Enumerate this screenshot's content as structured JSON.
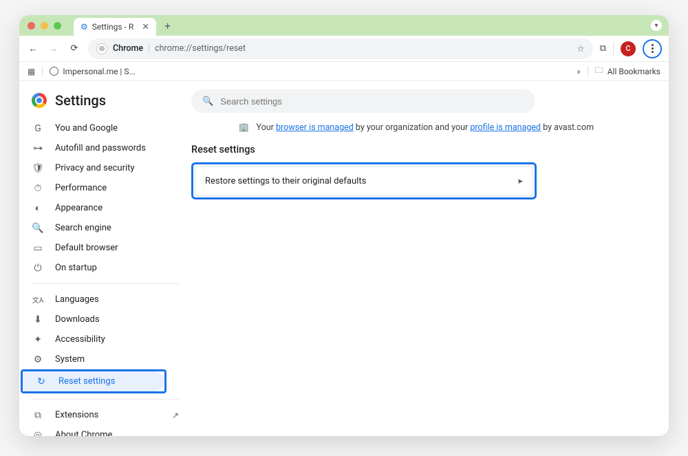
{
  "window": {
    "tab_title": "Settings - R",
    "new_tab_tooltip": "+"
  },
  "toolbar": {
    "chrome_label": "Chrome",
    "url": "chrome://settings/reset",
    "avatar_initial": "C"
  },
  "bookmarks_bar": {
    "item1": "Impersonal.me | S...",
    "all_bookmarks": "All Bookmarks"
  },
  "settings": {
    "title": "Settings",
    "search_placeholder": "Search settings",
    "managed_prefix": "Your ",
    "managed_link1": "browser is managed",
    "managed_mid": " by your organization and your ",
    "managed_link2": "profile is managed",
    "managed_suffix": " by avast.com",
    "section_title": "Reset settings",
    "restore_label": "Restore settings to their original defaults"
  },
  "sidebar": {
    "items": [
      {
        "label": "You and Google",
        "icon": "G"
      },
      {
        "label": "Autofill and passwords",
        "icon": "⊶"
      },
      {
        "label": "Privacy and security",
        "icon": "🛡"
      },
      {
        "label": "Performance",
        "icon": "⏱"
      },
      {
        "label": "Appearance",
        "icon": "◐"
      },
      {
        "label": "Search engine",
        "icon": "🔍"
      },
      {
        "label": "Default browser",
        "icon": "▭"
      },
      {
        "label": "On startup",
        "icon": "⏻"
      }
    ],
    "items2": [
      {
        "label": "Languages",
        "icon": "文A"
      },
      {
        "label": "Downloads",
        "icon": "⬇"
      },
      {
        "label": "Accessibility",
        "icon": "✦"
      },
      {
        "label": "System",
        "icon": "⚙"
      },
      {
        "label": "Reset settings",
        "icon": "↻"
      }
    ],
    "items3": [
      {
        "label": "Extensions",
        "icon": "⧉",
        "ext": "↗"
      },
      {
        "label": "About Chrome",
        "icon": "◎"
      }
    ]
  }
}
